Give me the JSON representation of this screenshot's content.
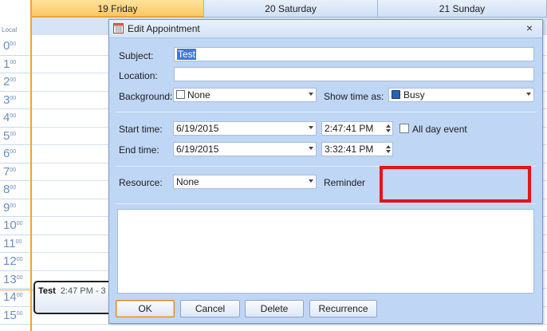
{
  "calendar": {
    "local_label": "Local",
    "hours": [
      "0",
      "1",
      "2",
      "3",
      "4",
      "5",
      "6",
      "7",
      "8",
      "9",
      "10",
      "11",
      "12",
      "13",
      "14",
      "15"
    ],
    "minutes_suffix": "00",
    "days": [
      {
        "label": "19 Friday"
      },
      {
        "label": "20 Saturday"
      },
      {
        "label": "21 Sunday"
      }
    ],
    "appointment": {
      "title": "Test",
      "time": "2:47 PM - 3"
    }
  },
  "dialog": {
    "title": "Edit Appointment",
    "close_label": "×",
    "subject_label": "Subject:",
    "subject_value": "Test",
    "location_label": "Location:",
    "location_value": "",
    "background_label": "Background:",
    "background_value": "None",
    "show_time_as_label": "Show time as:",
    "show_time_as_value": "Busy",
    "start_time_label": "Start time:",
    "start_date": "6/19/2015",
    "start_time": "2:47:41 PM",
    "all_day_label": "All day event",
    "all_day_checked": false,
    "end_time_label": "End time:",
    "end_date": "6/19/2015",
    "end_time": "3:32:41 PM",
    "resource_label": "Resource:",
    "resource_value": "None",
    "reminder_label": "Reminder",
    "notes_value": "",
    "buttons": {
      "ok": "OK",
      "cancel": "Cancel",
      "delete": "Delete",
      "recurrence": "Recurrence"
    }
  },
  "colors": {
    "dialog_bg": "#bfd6f5",
    "today_header": "#f8c766",
    "highlight_box": "#e3141b",
    "busy": "#2a5fb6"
  }
}
